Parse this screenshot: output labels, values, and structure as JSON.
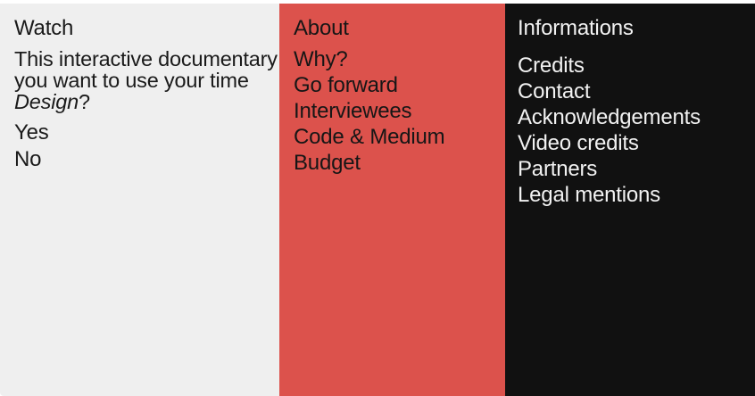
{
  "watch": {
    "title": "Watch",
    "intro_line1": "This interactive documentary",
    "intro_line2": "you want to use your time",
    "intro_em": "Design",
    "intro_end": "?",
    "choices": [
      "Yes",
      "No"
    ]
  },
  "about": {
    "title": "About",
    "links": [
      "Why?",
      "Go forward",
      "Interviewees",
      "Code & Medium",
      "Budget"
    ]
  },
  "informations": {
    "title": "Informations",
    "links": [
      "Credits",
      "Contact",
      "Acknowledgements",
      "Video credits",
      "Partners",
      "Legal mentions"
    ]
  },
  "colors": {
    "watch_bg": "#efefef",
    "about_bg": "#dc524c",
    "info_bg": "#111111",
    "info_text": "#f2f2f2"
  }
}
